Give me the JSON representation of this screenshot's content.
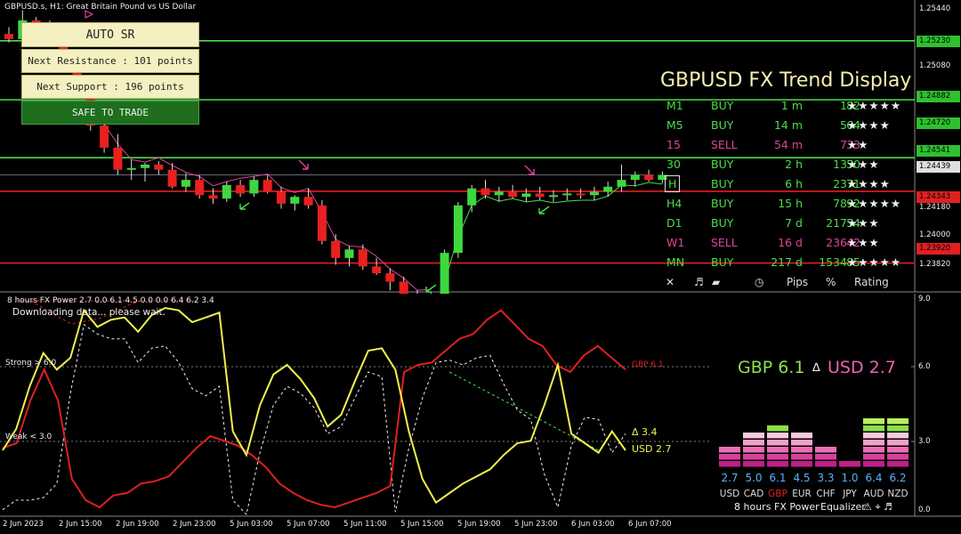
{
  "header": {
    "symbol_title": "GBPUSD.s, H1:  Great Britain Pound vs US Dollar",
    "indicator_title": "8 hours FX Power 2.7 0.0 6.1 4.5 0.0 0.0 6.4 6.2 3.4",
    "download_msg": "Downloading data... please wait."
  },
  "sr_panel": {
    "title": "AUTO  SR",
    "resistance": "Next Resistance : 101 points",
    "support": "Next Support : 196 points",
    "status": "SAFE TO TRADE"
  },
  "trend_display": {
    "title": "GBPUSD FX Trend Display",
    "rows": [
      {
        "tf": "M1",
        "signal": "BUY",
        "dur": "1 m",
        "pips": "1",
        "pct": "82",
        "stars": "★★★★★",
        "color": "#4ade4a"
      },
      {
        "tf": "M5",
        "signal": "BUY",
        "dur": "14 m",
        "pips": "5",
        "pct": "64",
        "stars": "★★★★",
        "color": "#4ade4a"
      },
      {
        "tf": "15",
        "signal": "SELL",
        "dur": "54 m",
        "pips": "7",
        "pct": "33",
        "stars": "★★",
        "color": "#e0439a"
      },
      {
        "tf": "30",
        "signal": "BUY",
        "dur": "2 h",
        "pips": "13",
        "pct": "50",
        "stars": "★★★",
        "color": "#4ade4a"
      },
      {
        "tf": "H",
        "signal": "BUY",
        "dur": "6 h",
        "pips": "23",
        "pct": "71",
        "stars": "★★★★",
        "color": "#4ade4a"
      },
      {
        "tf": "H4",
        "signal": "BUY",
        "dur": "15 h",
        "pips": "78",
        "pct": "92",
        "stars": "★★★★★",
        "color": "#4ade4a"
      },
      {
        "tf": "D1",
        "signal": "BUY",
        "dur": "7 d",
        "pips": "217",
        "pct": "54",
        "stars": "★★★",
        "color": "#4ade4a"
      },
      {
        "tf": "W1",
        "signal": "SELL",
        "dur": "16 d",
        "pips": "236",
        "pct": "42",
        "stars": "★★★",
        "color": "#e0439a"
      },
      {
        "tf": "MN",
        "signal": "BUY",
        "dur": "217 d",
        "pips": "1534",
        "pct": "85",
        "stars": "★★★★★",
        "color": "#4ade4a"
      }
    ],
    "footer": {
      "close": "✕",
      "music": "♬",
      "clock": "◷",
      "pips": "Pips",
      "pct": "%",
      "rating": "Rating"
    }
  },
  "price_axis": {
    "labels": [
      "1.25440",
      "1.25230",
      "1.25080",
      "1.24882",
      "1.24720",
      "1.24541",
      "1.24439",
      "1.24343",
      "1.24180",
      "1.24000",
      "1.23920",
      "1.23820"
    ]
  },
  "fx_power": {
    "gbp_label": "GBP 6.1",
    "delta_label": "∆",
    "usd_label": "USD 2.7",
    "strong_label": "Strong > 6.0",
    "weak_label": "Weak < 3.0",
    "gbp_line_label": "GBP 6.1",
    "delta_line_label": "Δ 3.4",
    "usd_line_label": "USD 2.7",
    "axis_labels": [
      "9.0",
      "6.0",
      "3.0",
      "0.0"
    ],
    "colors": {
      "gbp": "#e02020",
      "usd": "#f0f050",
      "gbp_big": "#90e050",
      "usd_big": "#f060b0",
      "delta": "#f0f050"
    }
  },
  "equalizer": {
    "currencies": [
      "USD",
      "CAD",
      "GBP",
      "EUR",
      "CHF",
      "JPY",
      "AUD",
      "NZD"
    ],
    "values": [
      "2.7",
      "5.0",
      "6.1",
      "4.5",
      "3.3",
      "1.0",
      "6.4",
      "6.2"
    ],
    "footer_hours": "8 hours",
    "footer_name": "FX Power",
    "footer_eq": "Equalizer",
    "footer_icons": "⚠ ⌖ ♬"
  },
  "time_axis": [
    "2 Jun 2023",
    "2 Jun 15:00",
    "2 Jun 19:00",
    "2 Jun 23:00",
    "5 Jun 03:00",
    "5 Jun 07:00",
    "5 Jun 11:00",
    "5 Jun 15:00",
    "5 Jun 19:00",
    "5 Jun 23:00",
    "6 Jun 03:00",
    "6 Jun 07:00"
  ],
  "chart_data": [
    {
      "type": "candlestick",
      "title": "GBPUSD.s, H1:  Great Britain Pound vs US Dollar",
      "ylim": [
        1.2375,
        1.2547
      ],
      "levels": {
        "resistance": [
          1.2523,
          1.24882,
          1.24541
        ],
        "support": [
          1.24343,
          1.2392
        ],
        "current": 1.24439
      },
      "candles": [
        {
          "o": 1.2527,
          "h": 1.2531,
          "l": 1.2522,
          "c": 1.2524
        },
        {
          "o": 1.2524,
          "h": 1.2541,
          "l": 1.2522,
          "c": 1.2535
        },
        {
          "o": 1.2535,
          "h": 1.2537,
          "l": 1.2527,
          "c": 1.253
        },
        {
          "o": 1.253,
          "h": 1.2535,
          "l": 1.252,
          "c": 1.2522
        },
        {
          "o": 1.2522,
          "h": 1.2526,
          "l": 1.2509,
          "c": 1.2511
        },
        {
          "o": 1.2511,
          "h": 1.2514,
          "l": 1.2493,
          "c": 1.2496
        },
        {
          "o": 1.2496,
          "h": 1.2499,
          "l": 1.247,
          "c": 1.2473
        },
        {
          "o": 1.2473,
          "h": 1.2479,
          "l": 1.2457,
          "c": 1.246
        },
        {
          "o": 1.246,
          "h": 1.2468,
          "l": 1.2444,
          "c": 1.2447
        },
        {
          "o": 1.2447,
          "h": 1.2453,
          "l": 1.2441,
          "c": 1.2448
        },
        {
          "o": 1.2448,
          "h": 1.2451,
          "l": 1.244,
          "c": 1.245
        },
        {
          "o": 1.245,
          "h": 1.2452,
          "l": 1.2444,
          "c": 1.2447
        },
        {
          "o": 1.2447,
          "h": 1.2451,
          "l": 1.2436,
          "c": 1.2437
        },
        {
          "o": 1.2437,
          "h": 1.2445,
          "l": 1.2434,
          "c": 1.2441
        },
        {
          "o": 1.2441,
          "h": 1.2444,
          "l": 1.243,
          "c": 1.2432
        },
        {
          "o": 1.2432,
          "h": 1.2436,
          "l": 1.2427,
          "c": 1.243
        },
        {
          "o": 1.243,
          "h": 1.244,
          "l": 1.2428,
          "c": 1.2438
        },
        {
          "o": 1.2438,
          "h": 1.2441,
          "l": 1.2431,
          "c": 1.2433
        },
        {
          "o": 1.2433,
          "h": 1.2443,
          "l": 1.2431,
          "c": 1.2441
        },
        {
          "o": 1.2441,
          "h": 1.2444,
          "l": 1.2433,
          "c": 1.2434
        },
        {
          "o": 1.2434,
          "h": 1.2437,
          "l": 1.2424,
          "c": 1.2427
        },
        {
          "o": 1.2427,
          "h": 1.2432,
          "l": 1.2423,
          "c": 1.2431
        },
        {
          "o": 1.2431,
          "h": 1.2436,
          "l": 1.2424,
          "c": 1.2426
        },
        {
          "o": 1.2426,
          "h": 1.2429,
          "l": 1.2403,
          "c": 1.2405
        },
        {
          "o": 1.2405,
          "h": 1.2409,
          "l": 1.2391,
          "c": 1.2395
        },
        {
          "o": 1.2395,
          "h": 1.2402,
          "l": 1.239,
          "c": 1.24
        },
        {
          "o": 1.24,
          "h": 1.2403,
          "l": 1.2388,
          "c": 1.239
        },
        {
          "o": 1.239,
          "h": 1.2395,
          "l": 1.2385,
          "c": 1.2386
        },
        {
          "o": 1.2386,
          "h": 1.2389,
          "l": 1.2376,
          "c": 1.2381
        },
        {
          "o": 1.2381,
          "h": 1.2384,
          "l": 1.237,
          "c": 1.2372
        },
        {
          "o": 1.2372,
          "h": 1.2376,
          "l": 1.2364,
          "c": 1.2369
        },
        {
          "o": 1.2369,
          "h": 1.2375,
          "l": 1.2366,
          "c": 1.2373
        },
        {
          "o": 1.2373,
          "h": 1.24,
          "l": 1.237,
          "c": 1.2398
        },
        {
          "o": 1.2398,
          "h": 1.2428,
          "l": 1.2395,
          "c": 1.2426
        },
        {
          "o": 1.2426,
          "h": 1.2438,
          "l": 1.2422,
          "c": 1.2436
        },
        {
          "o": 1.2436,
          "h": 1.2441,
          "l": 1.243,
          "c": 1.2432
        },
        {
          "o": 1.2432,
          "h": 1.2437,
          "l": 1.2428,
          "c": 1.2434
        },
        {
          "o": 1.2434,
          "h": 1.2438,
          "l": 1.243,
          "c": 1.2431
        },
        {
          "o": 1.2431,
          "h": 1.2436,
          "l": 1.2428,
          "c": 1.2433
        },
        {
          "o": 1.2433,
          "h": 1.2437,
          "l": 1.2429,
          "c": 1.2431
        },
        {
          "o": 1.2431,
          "h": 1.2435,
          "l": 1.2428,
          "c": 1.2432
        },
        {
          "o": 1.2432,
          "h": 1.2436,
          "l": 1.2429,
          "c": 1.2433
        },
        {
          "o": 1.2433,
          "h": 1.2436,
          "l": 1.243,
          "c": 1.2432
        },
        {
          "o": 1.2432,
          "h": 1.2437,
          "l": 1.2429,
          "c": 1.2434
        },
        {
          "o": 1.2434,
          "h": 1.244,
          "l": 1.2431,
          "c": 1.2437
        },
        {
          "o": 1.2437,
          "h": 1.245,
          "l": 1.2434,
          "c": 1.2441
        },
        {
          "o": 1.2441,
          "h": 1.2446,
          "l": 1.2437,
          "c": 1.2444
        },
        {
          "o": 1.2444,
          "h": 1.2447,
          "l": 1.244,
          "c": 1.2441
        },
        {
          "o": 1.2441,
          "h": 1.2446,
          "l": 1.2439,
          "c": 1.2444
        }
      ]
    },
    {
      "type": "line",
      "title": "8 hours FX Power 2.7 0.0 6.1 4.5 0.0 0.0 6.4 6.2 3.4",
      "ylim": [
        0,
        9
      ],
      "series": [
        {
          "name": "GBP",
          "values": [
            2.8,
            3.0,
            4.8,
            6.1,
            4.8,
            1.5,
            0.6,
            0.3,
            0.8,
            0.9,
            1.3,
            1.4,
            1.6,
            2.2,
            2.8,
            3.3,
            3.1,
            2.9,
            2.5,
            2.0,
            1.3,
            0.9,
            0.6,
            0.4,
            0.3,
            0.5,
            0.7,
            0.9,
            1.2,
            6.0,
            6.3,
            6.4,
            6.9,
            7.4,
            7.6,
            8.2,
            8.6,
            8.0,
            7.4,
            7.1,
            6.3,
            6.0,
            6.7,
            7.1,
            6.6,
            6.1
          ]
        },
        {
          "name": "USD",
          "values": [
            2.7,
            3.6,
            5.4,
            6.8,
            6.1,
            6.6,
            8.6,
            7.9,
            8.2,
            8.3,
            7.7,
            8.4,
            8.7,
            8.6,
            8.1,
            8.3,
            8.5,
            3.5,
            2.5,
            4.6,
            5.9,
            6.3,
            5.7,
            4.9,
            3.7,
            4.2,
            5.6,
            6.9,
            7.0,
            6.1,
            3.5,
            1.5,
            0.5,
            0.9,
            1.3,
            1.6,
            1.9,
            2.5,
            3.0,
            3.1,
            4.6,
            6.3,
            3.4,
            3.0,
            2.6,
            3.5,
            2.7
          ]
        },
        {
          "name": "Δ",
          "values": [
            0.2,
            0.6,
            0.6,
            0.7,
            1.3,
            5.1,
            8.0,
            7.6,
            7.4,
            7.4,
            6.4,
            7.0,
            7.1,
            6.4,
            5.3,
            5.0,
            5.4,
            0.6,
            0.0,
            2.6,
            4.6,
            5.4,
            5.1,
            4.5,
            3.4,
            3.7,
            4.9,
            6.0,
            5.8,
            0.1,
            2.8,
            4.9,
            6.4,
            6.5,
            6.3,
            6.6,
            6.7,
            5.5,
            4.4,
            4.0,
            1.7,
            0.3,
            2.9,
            4.1,
            4.0,
            2.6,
            3.4
          ]
        }
      ]
    },
    {
      "type": "bar",
      "title": "Equalizer",
      "categories": [
        "USD",
        "CAD",
        "GBP",
        "EUR",
        "CHF",
        "JPY",
        "AUD",
        "NZD"
      ],
      "values": [
        2.7,
        5.0,
        6.1,
        4.5,
        3.3,
        1.0,
        6.4,
        6.2
      ]
    }
  ]
}
